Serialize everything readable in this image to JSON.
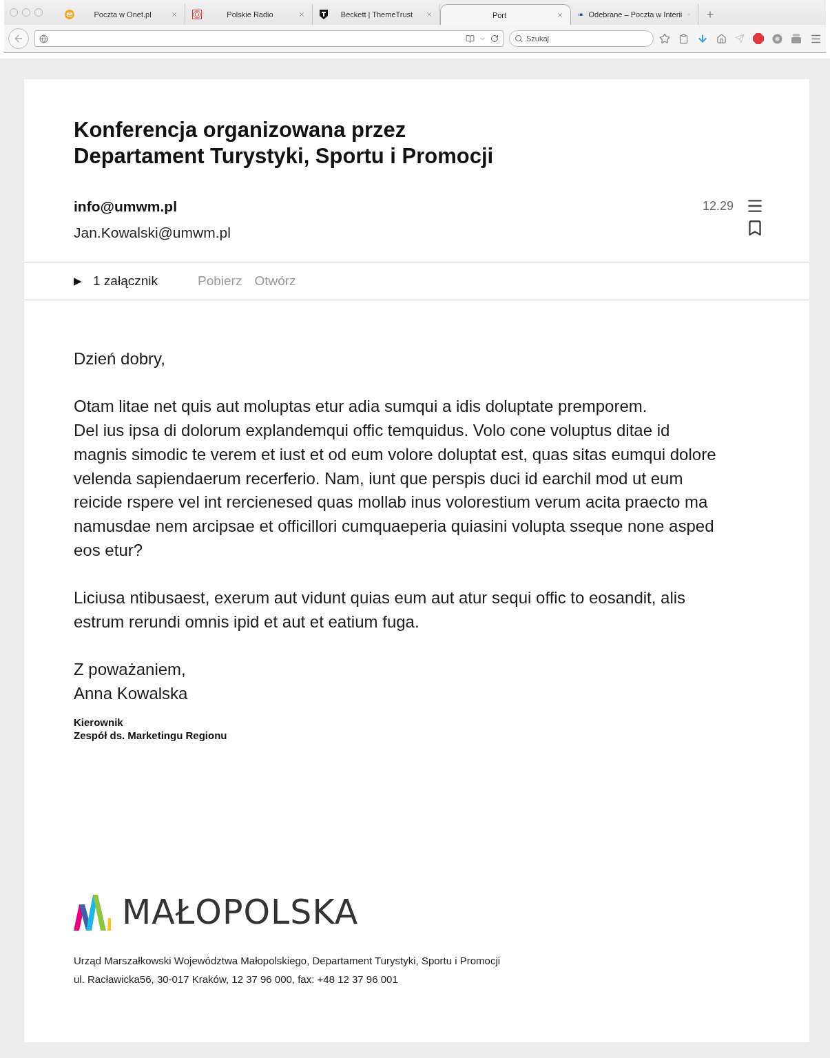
{
  "browser": {
    "tabs": [
      {
        "title": "Poczta w Onet.pl",
        "selected": false,
        "kind": "mail"
      },
      {
        "title": "Polskie Radio",
        "selected": false,
        "kind": "radio"
      },
      {
        "title": "Beckett | ThemeTrust",
        "selected": false,
        "kind": "shield"
      },
      {
        "title": "Port",
        "selected": true,
        "kind": "none"
      },
      {
        "title": "Odebrane – Poczta w Interii",
        "selected": false,
        "kind": "square"
      }
    ],
    "search": {
      "placeholder": "Szukaj"
    }
  },
  "email": {
    "subject": [
      "Konferencja organizowana przez",
      "Departament Turystyki, Sportu i Promocji"
    ],
    "from": "info@umwm.pl",
    "to": "Jan.Kowalski@umwm.pl",
    "time": "12.29",
    "attachments": {
      "expand_icon": "▶",
      "label": "1 załącznik",
      "actions": [
        "Pobierz",
        "Otwórz"
      ]
    },
    "body": {
      "greeting": "Dzień dobry,",
      "paragraphs": [
        "Otam litae net quis aut moluptas etur adia sumqui a idis doluptate premporem.\nDel ius ipsa di dolorum explandemqui offic temquidus. Volo cone voluptus ditae id magnis simodic te verem et iust et od eum volore doluptat est, quas sitas eumqui dolore velenda sapiendaerum recerferio. Nam, iunt que perspis duci id earchil mod ut eum reicide rspere vel int rercienesed quas mollab inus volorestium verum acita praecto ma namusdae nem arcipsae et officillori cumquaeperia quiasini volupta sseque none asped eos etur?",
        "Liciusa ntibusaest, exerum aut vidunt quias eum aut atur sequi offic to eosandit, alis estrum rerundi omnis ipid et aut et eatium fuga."
      ],
      "closing": "Z poważaniem,",
      "name": "Anna Kowalska",
      "role": "Kierownik",
      "team": "Zespół ds. Marketingu Regionu"
    },
    "footer": {
      "logo": "MAŁOPOLSKA",
      "lines": [
        "Urząd Marszałkowski Województwa Małopolskiego, Departament Turystyki, Sportu i Promocji",
        "ul. Racławicka56, 30-017 Kraków, 12 37 96 000, fax: +48 12 37 96 001"
      ]
    }
  }
}
